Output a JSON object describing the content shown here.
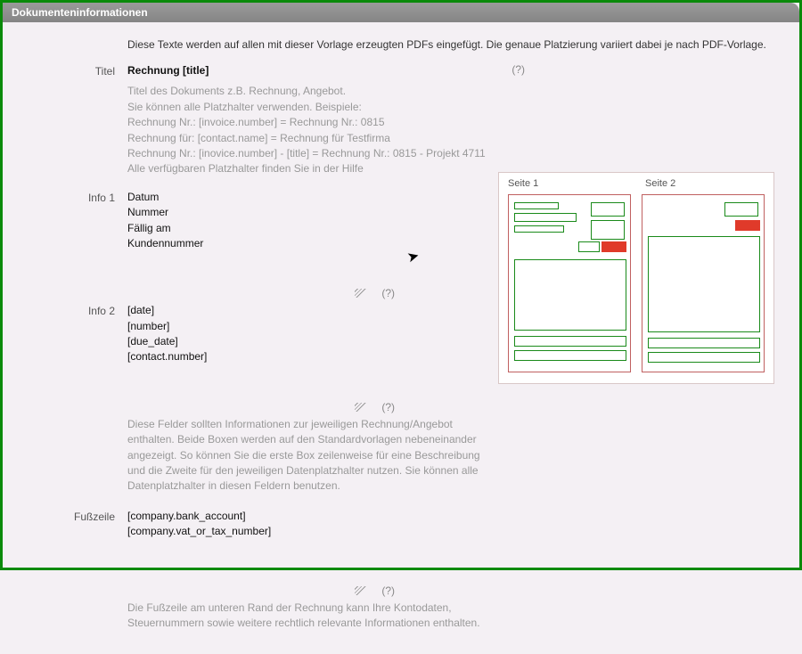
{
  "header": {
    "title": "Dokumenteninformationen"
  },
  "intro": "Diese Texte werden auf allen mit dieser Vorlage erzeugten PDFs eingefügt. Die genaue Platzierung variiert dabei je nach PDF-Vorlage.",
  "title_section": {
    "label": "Titel",
    "value": "Rechnung [title]",
    "hint": "(?)",
    "help": [
      "Titel des Dokuments z.B. Rechnung, Angebot.",
      "Sie können alle Platzhalter verwenden. Beispiele:",
      "Rechnung Nr.: [invoice.number] = Rechnung Nr.: 0815",
      "Rechnung für: [contact.name] = Rechnung für Testfirma",
      "Rechnung Nr.: [inovice.number] - [title] = Rechnung Nr.: 0815 - Projekt 4711",
      "Alle verfügbaren Platzhalter finden Sie in der Hilfe"
    ]
  },
  "info1": {
    "label": "Info 1",
    "lines": [
      "Datum",
      "Nummer",
      "Fällig am",
      "Kundennummer"
    ],
    "hint": "(?)"
  },
  "info2": {
    "label": "Info 2",
    "lines": [
      "[date]",
      "[number]",
      "[due_date]",
      "[contact.number]"
    ],
    "hint": "(?)"
  },
  "info_desc": "Diese Felder sollten Informationen zur jeweiligen Rechnung/Angebot enthalten. Beide Boxen werden auf den Standardvorlagen nebeneinander angezeigt. So können Sie die erste Box zeilenweise für eine Beschreibung und die Zweite für den jeweiligen Datenplatzhalter nutzen. Sie können alle Datenplatzhalter in diesen Feldern benutzen.",
  "footer": {
    "label": "Fußzeile",
    "lines": [
      "[company.bank_account]",
      "[company.vat_or_tax_number]"
    ],
    "hint": "(?)",
    "desc": "Die Fußzeile am unteren Rand der Rechnung kann Ihre Kontodaten, Steuernummern sowie weitere rechtlich relevante Informationen enthalten."
  },
  "preview": {
    "page1_label": "Seite 1",
    "page2_label": "Seite 2"
  }
}
